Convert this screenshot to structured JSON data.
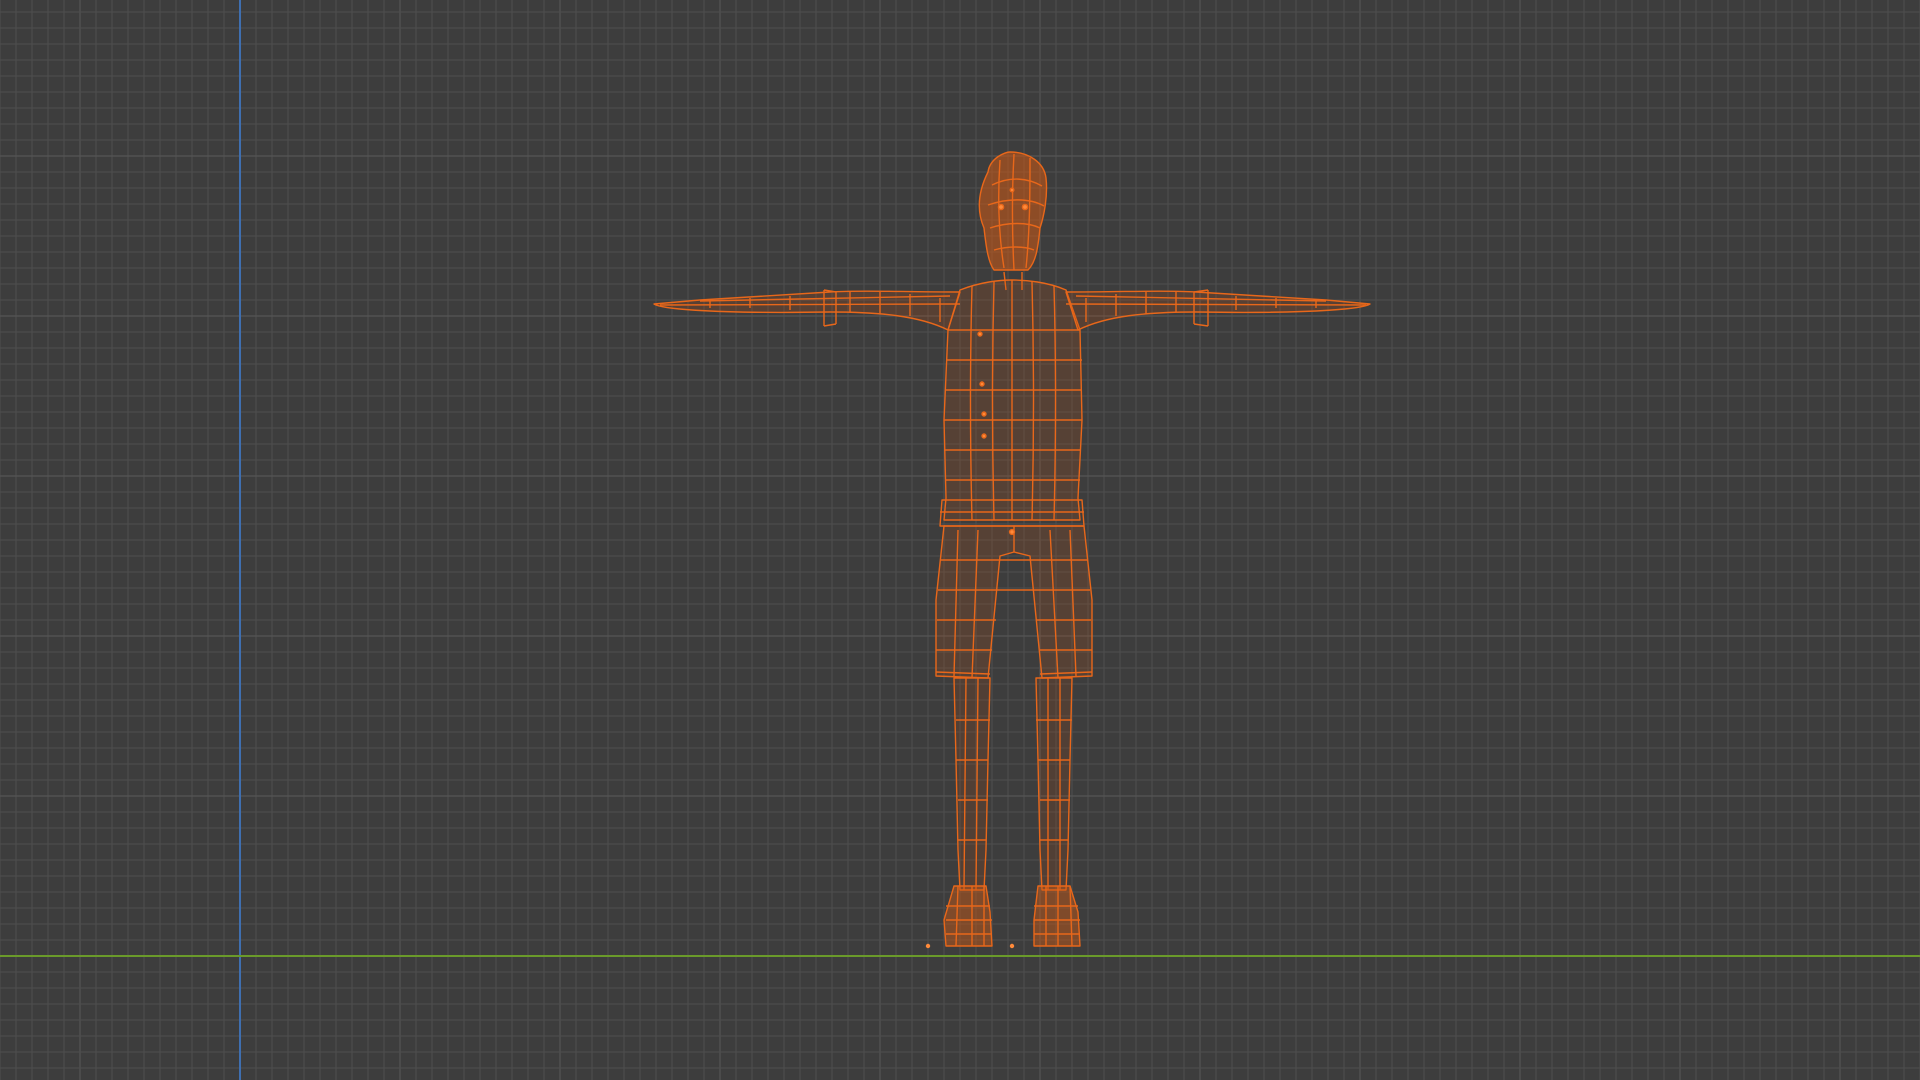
{
  "viewport": {
    "view": "front-orthographic",
    "shading": "wireframe",
    "background_color": "#3d3d3d",
    "grid_color": "#4e4e4e",
    "grid_major_color": "#555555",
    "axis_x_color": "#6a9a2a",
    "axis_z_color": "#3f6fb0",
    "selection_color": "#e8671a",
    "selection_highlight_color": "#ff8a3a"
  },
  "object": {
    "name_icon": "human-mesh-icon",
    "pose": "T-pose",
    "selected": true
  }
}
